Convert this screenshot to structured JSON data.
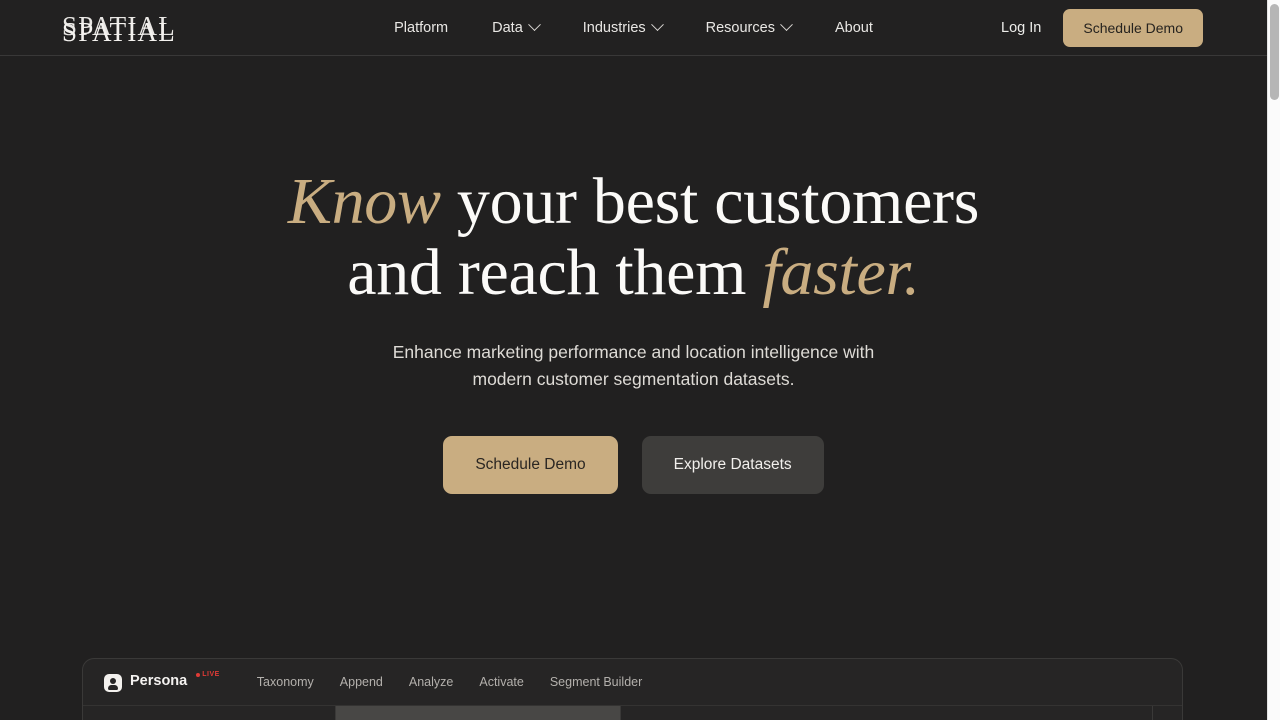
{
  "brand": {
    "logo_text": "SPATIAL"
  },
  "nav": {
    "items": [
      {
        "label": "Platform",
        "has_dropdown": false
      },
      {
        "label": "Data",
        "has_dropdown": true
      },
      {
        "label": "Industries",
        "has_dropdown": true
      },
      {
        "label": "Resources",
        "has_dropdown": true
      },
      {
        "label": "About",
        "has_dropdown": false
      }
    ],
    "login_label": "Log In",
    "demo_button_label": "Schedule Demo"
  },
  "hero": {
    "headline_line1_gold": "Know",
    "headline_line1_rest": " your best customers",
    "headline_line2_rest": "and reach them ",
    "headline_line2_gold": "faster.",
    "subtitle_line1": "Enhance marketing performance and location intelligence with",
    "subtitle_line2": "modern customer segmentation datasets.",
    "cta_primary": "Schedule Demo",
    "cta_secondary": "Explore Datasets"
  },
  "app_preview": {
    "product_name": "Persona",
    "live_label": "LIVE",
    "tabs": [
      {
        "label": "Taxonomy"
      },
      {
        "label": "Append"
      },
      {
        "label": "Analyze"
      },
      {
        "label": "Activate"
      },
      {
        "label": "Segment Builder"
      }
    ]
  },
  "colors": {
    "background": "#212020",
    "header": "#222121",
    "accent_gold": "#c9ad81",
    "text_primary": "#fbfaf8",
    "text_secondary": "#dedbd6",
    "button_secondary": "#3e3d3b",
    "live_red": "#e03b36",
    "panel": "#262525"
  }
}
